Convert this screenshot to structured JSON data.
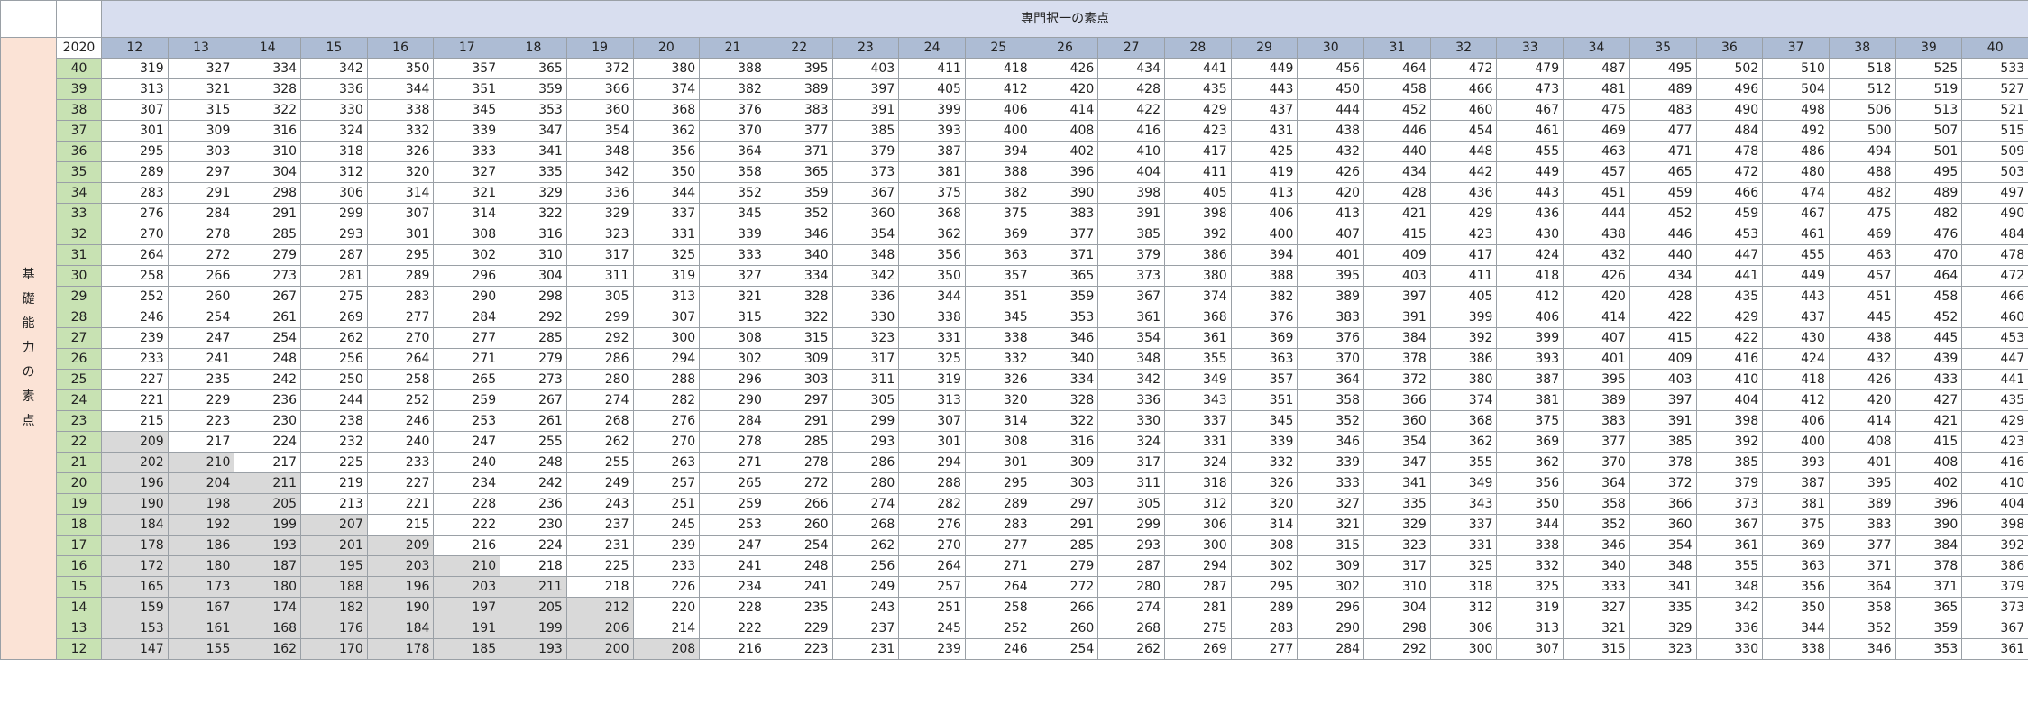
{
  "title": "専門択一の素点",
  "year": "2020",
  "side_label": "基礎能力の素点",
  "columns": [
    "12",
    "13",
    "14",
    "15",
    "16",
    "17",
    "18",
    "19",
    "20",
    "21",
    "22",
    "23",
    "24",
    "25",
    "26",
    "27",
    "28",
    "29",
    "30",
    "31",
    "32",
    "33",
    "34",
    "35",
    "36",
    "37",
    "38",
    "39",
    "40"
  ],
  "shade_color": "#d9d9d9",
  "rows": [
    {
      "label": "40",
      "values": [
        "319",
        "327",
        "334",
        "342",
        "350",
        "357",
        "365",
        "372",
        "380",
        "388",
        "395",
        "403",
        "411",
        "418",
        "426",
        "434",
        "441",
        "449",
        "456",
        "464",
        "472",
        "479",
        "487",
        "495",
        "502",
        "510",
        "518",
        "525",
        "533"
      ],
      "shaded": 0
    },
    {
      "label": "39",
      "values": [
        "313",
        "321",
        "328",
        "336",
        "344",
        "351",
        "359",
        "366",
        "374",
        "382",
        "389",
        "397",
        "405",
        "412",
        "420",
        "428",
        "435",
        "443",
        "450",
        "458",
        "466",
        "473",
        "481",
        "489",
        "496",
        "504",
        "512",
        "519",
        "527"
      ],
      "shaded": 0
    },
    {
      "label": "38",
      "values": [
        "307",
        "315",
        "322",
        "330",
        "338",
        "345",
        "353",
        "360",
        "368",
        "376",
        "383",
        "391",
        "399",
        "406",
        "414",
        "422",
        "429",
        "437",
        "444",
        "452",
        "460",
        "467",
        "475",
        "483",
        "490",
        "498",
        "506",
        "513",
        "521"
      ],
      "shaded": 0
    },
    {
      "label": "37",
      "values": [
        "301",
        "309",
        "316",
        "324",
        "332",
        "339",
        "347",
        "354",
        "362",
        "370",
        "377",
        "385",
        "393",
        "400",
        "408",
        "416",
        "423",
        "431",
        "438",
        "446",
        "454",
        "461",
        "469",
        "477",
        "484",
        "492",
        "500",
        "507",
        "515"
      ],
      "shaded": 0
    },
    {
      "label": "36",
      "values": [
        "295",
        "303",
        "310",
        "318",
        "326",
        "333",
        "341",
        "348",
        "356",
        "364",
        "371",
        "379",
        "387",
        "394",
        "402",
        "410",
        "417",
        "425",
        "432",
        "440",
        "448",
        "455",
        "463",
        "471",
        "478",
        "486",
        "494",
        "501",
        "509"
      ],
      "shaded": 0
    },
    {
      "label": "35",
      "values": [
        "289",
        "297",
        "304",
        "312",
        "320",
        "327",
        "335",
        "342",
        "350",
        "358",
        "365",
        "373",
        "381",
        "388",
        "396",
        "404",
        "411",
        "419",
        "426",
        "434",
        "442",
        "449",
        "457",
        "465",
        "472",
        "480",
        "488",
        "495",
        "503"
      ],
      "shaded": 0
    },
    {
      "label": "34",
      "values": [
        "283",
        "291",
        "298",
        "306",
        "314",
        "321",
        "329",
        "336",
        "344",
        "352",
        "359",
        "367",
        "375",
        "382",
        "390",
        "398",
        "405",
        "413",
        "420",
        "428",
        "436",
        "443",
        "451",
        "459",
        "466",
        "474",
        "482",
        "489",
        "497"
      ],
      "shaded": 0
    },
    {
      "label": "33",
      "values": [
        "276",
        "284",
        "291",
        "299",
        "307",
        "314",
        "322",
        "329",
        "337",
        "345",
        "352",
        "360",
        "368",
        "375",
        "383",
        "391",
        "398",
        "406",
        "413",
        "421",
        "429",
        "436",
        "444",
        "452",
        "459",
        "467",
        "475",
        "482",
        "490"
      ],
      "shaded": 0
    },
    {
      "label": "32",
      "values": [
        "270",
        "278",
        "285",
        "293",
        "301",
        "308",
        "316",
        "323",
        "331",
        "339",
        "346",
        "354",
        "362",
        "369",
        "377",
        "385",
        "392",
        "400",
        "407",
        "415",
        "423",
        "430",
        "438",
        "446",
        "453",
        "461",
        "469",
        "476",
        "484"
      ],
      "shaded": 0
    },
    {
      "label": "31",
      "values": [
        "264",
        "272",
        "279",
        "287",
        "295",
        "302",
        "310",
        "317",
        "325",
        "333",
        "340",
        "348",
        "356",
        "363",
        "371",
        "379",
        "386",
        "394",
        "401",
        "409",
        "417",
        "424",
        "432",
        "440",
        "447",
        "455",
        "463",
        "470",
        "478"
      ],
      "shaded": 0
    },
    {
      "label": "30",
      "values": [
        "258",
        "266",
        "273",
        "281",
        "289",
        "296",
        "304",
        "311",
        "319",
        "327",
        "334",
        "342",
        "350",
        "357",
        "365",
        "373",
        "380",
        "388",
        "395",
        "403",
        "411",
        "418",
        "426",
        "434",
        "441",
        "449",
        "457",
        "464",
        "472"
      ],
      "shaded": 0
    },
    {
      "label": "29",
      "values": [
        "252",
        "260",
        "267",
        "275",
        "283",
        "290",
        "298",
        "305",
        "313",
        "321",
        "328",
        "336",
        "344",
        "351",
        "359",
        "367",
        "374",
        "382",
        "389",
        "397",
        "405",
        "412",
        "420",
        "428",
        "435",
        "443",
        "451",
        "458",
        "466"
      ],
      "shaded": 0
    },
    {
      "label": "28",
      "values": [
        "246",
        "254",
        "261",
        "269",
        "277",
        "284",
        "292",
        "299",
        "307",
        "315",
        "322",
        "330",
        "338",
        "345",
        "353",
        "361",
        "368",
        "376",
        "383",
        "391",
        "399",
        "406",
        "414",
        "422",
        "429",
        "437",
        "445",
        "452",
        "460"
      ],
      "shaded": 0
    },
    {
      "label": "27",
      "values": [
        "239",
        "247",
        "254",
        "262",
        "270",
        "277",
        "285",
        "292",
        "300",
        "308",
        "315",
        "323",
        "331",
        "338",
        "346",
        "354",
        "361",
        "369",
        "376",
        "384",
        "392",
        "399",
        "407",
        "415",
        "422",
        "430",
        "438",
        "445",
        "453"
      ],
      "shaded": 0
    },
    {
      "label": "26",
      "values": [
        "233",
        "241",
        "248",
        "256",
        "264",
        "271",
        "279",
        "286",
        "294",
        "302",
        "309",
        "317",
        "325",
        "332",
        "340",
        "348",
        "355",
        "363",
        "370",
        "378",
        "386",
        "393",
        "401",
        "409",
        "416",
        "424",
        "432",
        "439",
        "447"
      ],
      "shaded": 0
    },
    {
      "label": "25",
      "values": [
        "227",
        "235",
        "242",
        "250",
        "258",
        "265",
        "273",
        "280",
        "288",
        "296",
        "303",
        "311",
        "319",
        "326",
        "334",
        "342",
        "349",
        "357",
        "364",
        "372",
        "380",
        "387",
        "395",
        "403",
        "410",
        "418",
        "426",
        "433",
        "441"
      ],
      "shaded": 0
    },
    {
      "label": "24",
      "values": [
        "221",
        "229",
        "236",
        "244",
        "252",
        "259",
        "267",
        "274",
        "282",
        "290",
        "297",
        "305",
        "313",
        "320",
        "328",
        "336",
        "343",
        "351",
        "358",
        "366",
        "374",
        "381",
        "389",
        "397",
        "404",
        "412",
        "420",
        "427",
        "435"
      ],
      "shaded": 0
    },
    {
      "label": "23",
      "values": [
        "215",
        "223",
        "230",
        "238",
        "246",
        "253",
        "261",
        "268",
        "276",
        "284",
        "291",
        "299",
        "307",
        "314",
        "322",
        "330",
        "337",
        "345",
        "352",
        "360",
        "368",
        "375",
        "383",
        "391",
        "398",
        "406",
        "414",
        "421",
        "429"
      ],
      "shaded": 0
    },
    {
      "label": "22",
      "values": [
        "209",
        "217",
        "224",
        "232",
        "240",
        "247",
        "255",
        "262",
        "270",
        "278",
        "285",
        "293",
        "301",
        "308",
        "316",
        "324",
        "331",
        "339",
        "346",
        "354",
        "362",
        "369",
        "377",
        "385",
        "392",
        "400",
        "408",
        "415",
        "423"
      ],
      "shaded": 1
    },
    {
      "label": "21",
      "values": [
        "202",
        "210",
        "217",
        "225",
        "233",
        "240",
        "248",
        "255",
        "263",
        "271",
        "278",
        "286",
        "294",
        "301",
        "309",
        "317",
        "324",
        "332",
        "339",
        "347",
        "355",
        "362",
        "370",
        "378",
        "385",
        "393",
        "401",
        "408",
        "416"
      ],
      "shaded": 2
    },
    {
      "label": "20",
      "values": [
        "196",
        "204",
        "211",
        "219",
        "227",
        "234",
        "242",
        "249",
        "257",
        "265",
        "272",
        "280",
        "288",
        "295",
        "303",
        "311",
        "318",
        "326",
        "333",
        "341",
        "349",
        "356",
        "364",
        "372",
        "379",
        "387",
        "395",
        "402",
        "410"
      ],
      "shaded": 3
    },
    {
      "label": "19",
      "values": [
        "190",
        "198",
        "205",
        "213",
        "221",
        "228",
        "236",
        "243",
        "251",
        "259",
        "266",
        "274",
        "282",
        "289",
        "297",
        "305",
        "312",
        "320",
        "327",
        "335",
        "343",
        "350",
        "358",
        "366",
        "373",
        "381",
        "389",
        "396",
        "404"
      ],
      "shaded": 3
    },
    {
      "label": "18",
      "values": [
        "184",
        "192",
        "199",
        "207",
        "215",
        "222",
        "230",
        "237",
        "245",
        "253",
        "260",
        "268",
        "276",
        "283",
        "291",
        "299",
        "306",
        "314",
        "321",
        "329",
        "337",
        "344",
        "352",
        "360",
        "367",
        "375",
        "383",
        "390",
        "398"
      ],
      "shaded": 4
    },
    {
      "label": "17",
      "values": [
        "178",
        "186",
        "193",
        "201",
        "209",
        "216",
        "224",
        "231",
        "239",
        "247",
        "254",
        "262",
        "270",
        "277",
        "285",
        "293",
        "300",
        "308",
        "315",
        "323",
        "331",
        "338",
        "346",
        "354",
        "361",
        "369",
        "377",
        "384",
        "392"
      ],
      "shaded": 5
    },
    {
      "label": "16",
      "values": [
        "172",
        "180",
        "187",
        "195",
        "203",
        "210",
        "218",
        "225",
        "233",
        "241",
        "248",
        "256",
        "264",
        "271",
        "279",
        "287",
        "294",
        "302",
        "309",
        "317",
        "325",
        "332",
        "340",
        "348",
        "355",
        "363",
        "371",
        "378",
        "386"
      ],
      "shaded": 6
    },
    {
      "label": "15",
      "values": [
        "165",
        "173",
        "180",
        "188",
        "196",
        "203",
        "211",
        "218",
        "226",
        "234",
        "241",
        "249",
        "257",
        "264",
        "272",
        "280",
        "287",
        "295",
        "302",
        "310",
        "318",
        "325",
        "333",
        "341",
        "348",
        "356",
        "364",
        "371",
        "379"
      ],
      "shaded": 7
    },
    {
      "label": "14",
      "values": [
        "159",
        "167",
        "174",
        "182",
        "190",
        "197",
        "205",
        "212",
        "220",
        "228",
        "235",
        "243",
        "251",
        "258",
        "266",
        "274",
        "281",
        "289",
        "296",
        "304",
        "312",
        "319",
        "327",
        "335",
        "342",
        "350",
        "358",
        "365",
        "373"
      ],
      "shaded": 8
    },
    {
      "label": "13",
      "values": [
        "153",
        "161",
        "168",
        "176",
        "184",
        "191",
        "199",
        "206",
        "214",
        "222",
        "229",
        "237",
        "245",
        "252",
        "260",
        "268",
        "275",
        "283",
        "290",
        "298",
        "306",
        "313",
        "321",
        "329",
        "336",
        "344",
        "352",
        "359",
        "367"
      ],
      "shaded": 8
    },
    {
      "label": "12",
      "values": [
        "147",
        "155",
        "162",
        "170",
        "178",
        "185",
        "193",
        "200",
        "208",
        "216",
        "223",
        "231",
        "239",
        "246",
        "254",
        "262",
        "269",
        "277",
        "284",
        "292",
        "300",
        "307",
        "315",
        "323",
        "330",
        "338",
        "346",
        "353",
        "361"
      ],
      "shaded": 9
    }
  ]
}
